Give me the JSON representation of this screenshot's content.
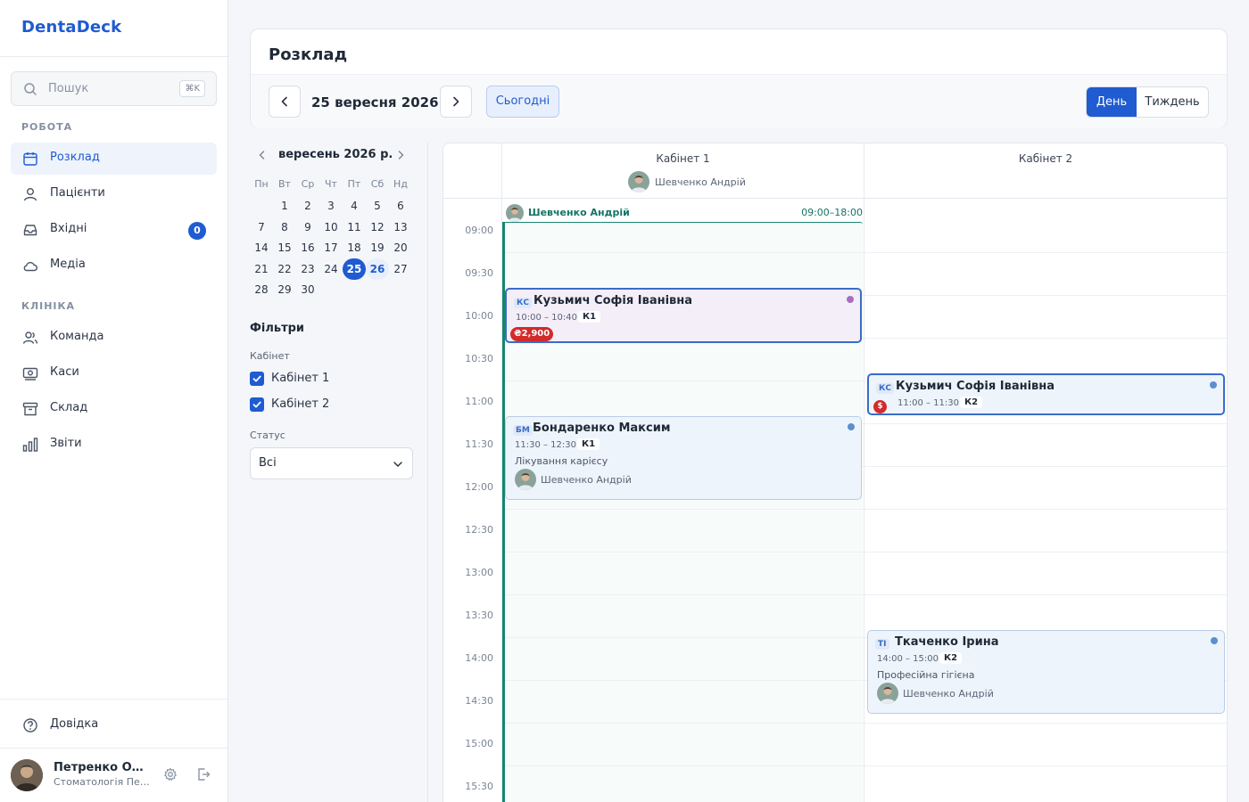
{
  "app": {
    "name": "DentaDeck"
  },
  "search": {
    "placeholder": "Пошук",
    "shortcut": "⌘K"
  },
  "sidebar": {
    "work_label": "РОБОТА",
    "work_items": [
      {
        "label": "Розклад",
        "icon": "calendar-icon",
        "active": true
      },
      {
        "label": "Пацієнти",
        "icon": "users-icon"
      },
      {
        "label": "Вхідні",
        "icon": "inbox-icon",
        "badge": "0"
      },
      {
        "label": "Медіа",
        "icon": "cloud-icon"
      }
    ],
    "clinic_label": "КЛІНІКА",
    "clinic_items": [
      {
        "label": "Команда",
        "icon": "team-icon"
      },
      {
        "label": "Каси",
        "icon": "cash-icon"
      },
      {
        "label": "Склад",
        "icon": "archive-icon"
      },
      {
        "label": "Звіти",
        "icon": "chart-icon"
      }
    ],
    "help_label": "Довідка",
    "user": {
      "name": "Петренко Олександр",
      "subtitle": "Стоматологія Петренко"
    }
  },
  "header": {
    "title": "Розклад",
    "date": "25 вересня 2026",
    "today_label": "Сьогодні",
    "views": {
      "day": "День",
      "week": "Тиждень",
      "active": "day"
    }
  },
  "mini_calendar": {
    "title": "вересень 2026 р.",
    "weekdays": [
      "Пн",
      "Вт",
      "Ср",
      "Чт",
      "Пт",
      "Сб",
      "Нд"
    ],
    "first_weekday_offset": 1,
    "days_in_month": 30,
    "selected_day": 25,
    "highlighted_day": 26
  },
  "filters": {
    "title": "Фільтри",
    "room_label": "Кабінет",
    "rooms": [
      {
        "label": "Кабінет 1",
        "checked": true
      },
      {
        "label": "Кабінет 2",
        "checked": true
      }
    ],
    "status_label": "Статус",
    "status_value": "Всі"
  },
  "schedule": {
    "columns": [
      {
        "title": "Кабінет 1",
        "doctor": "Шевченко Андрій"
      },
      {
        "title": "Кабінет 2"
      }
    ],
    "times": [
      "09:00",
      "09:30",
      "10:00",
      "10:30",
      "11:00",
      "11:30",
      "12:00",
      "12:30",
      "13:00",
      "13:30",
      "14:00",
      "14:30",
      "15:00",
      "15:30"
    ],
    "shift": {
      "doctor": "Шевченко Андрій",
      "time": "09:00–18:00",
      "column": 0
    },
    "appointments": [
      {
        "patient": "Кузьмич Софія Іванівна",
        "initials": "КС",
        "time": "10:00 – 10:40",
        "room": "К1",
        "column": 0,
        "start": "10:00",
        "end": "10:40",
        "selected": true,
        "color": "#a56fc2",
        "price": "₴2,900",
        "style": "violet"
      },
      {
        "patient": "Бондаренко Максим",
        "initials": "БМ",
        "time": "11:30 – 12:30",
        "room": "К1",
        "column": 0,
        "start": "11:30",
        "end": "12:30",
        "color": "#5b8fd0",
        "procedure": "Лікування карієсу",
        "doctor": "Шевченко Андрій"
      },
      {
        "patient": "Кузьмич Софія Іванівна",
        "initials": "КС",
        "time": "11:00 – 11:30",
        "room": "К2",
        "column": 1,
        "start": "11:00",
        "end": "11:30",
        "selected": true,
        "color": "#5b8fd0",
        "unpaid_mark": "$"
      },
      {
        "patient": "Ткаченко Ірина",
        "initials": "ТІ",
        "time": "14:00 – 15:00",
        "room": "К2",
        "column": 1,
        "start": "14:00",
        "end": "15:00",
        "color": "#5b8fd0",
        "procedure": "Професійна гігієна",
        "doctor": "Шевченко Андрій"
      }
    ]
  },
  "colors": {
    "accent": "#1f5bd1",
    "shift": "#16856f",
    "price": "#d12b2b"
  }
}
